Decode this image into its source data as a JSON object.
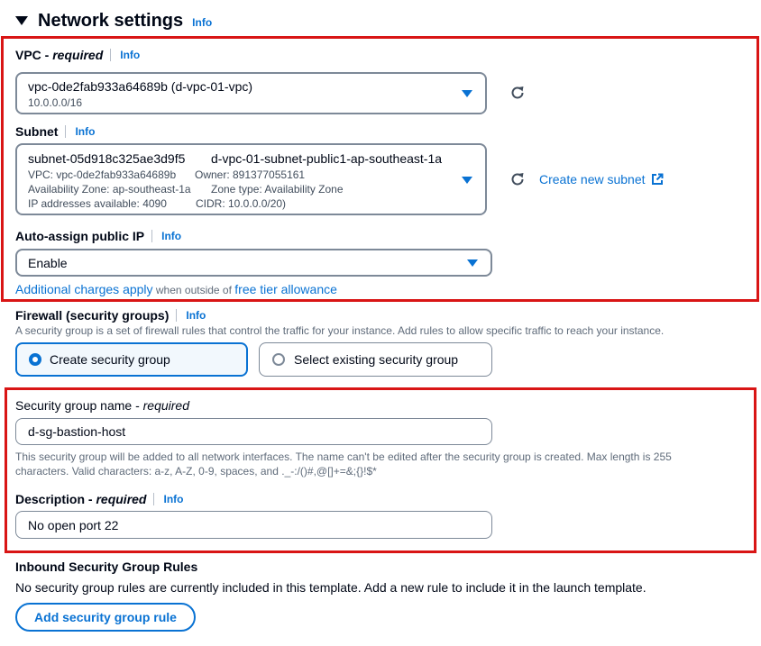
{
  "section": {
    "title": "Network settings",
    "info": "Info"
  },
  "vpc": {
    "label_main": "VPC - ",
    "label_req": "required",
    "info": "Info",
    "value": "vpc-0de2fab933a64689b (d-vpc-01-vpc)",
    "sub": "10.0.0.0/16"
  },
  "subnet": {
    "label": "Subnet",
    "info": "Info",
    "id": "subnet-05d918c325ae3d9f5",
    "name": "d-vpc-01-subnet-public1-ap-southeast-1a",
    "vpc_line": "VPC: vpc-0de2fab933a64689b",
    "owner_line": "Owner: 891377055161",
    "az_line": "Availability Zone: ap-southeast-1a",
    "zone_type_line": "Zone type: Availability Zone",
    "ips_line": "IP addresses available: 4090",
    "cidr_line": "CIDR: 10.0.0.0/20)",
    "create_link": "Create new subnet"
  },
  "auto_ip": {
    "label": "Auto-assign public IP",
    "info": "Info",
    "value": "Enable",
    "charges_link": "Additional charges apply",
    "charges_mid": " when outside of ",
    "free_tier_link": "free tier allowance"
  },
  "firewall": {
    "label": "Firewall (security groups)",
    "info": "Info",
    "description": "A security group is a set of firewall rules that control the traffic for your instance. Add rules to allow specific traffic to reach your instance.",
    "option_create": "Create security group",
    "option_select": "Select existing security group",
    "selected": "Create security group"
  },
  "sg_name": {
    "label_main": "Security group name - ",
    "label_req": "required",
    "value": "d-sg-bastion-host",
    "hint_line1": "This security group will be added to all network interfaces. The name can't be edited after the security group is created. Max length is 255",
    "hint_line2": "characters. Valid characters: a-z, A-Z, 0-9, spaces, and ._-:/()#,@[]+=&;{}!$*"
  },
  "description": {
    "label_main": "Description - ",
    "label_req": "required",
    "info": "Info",
    "value": "No open port 22"
  },
  "inbound": {
    "title": "Inbound Security Group Rules",
    "text": "No security group rules are currently included in this template. Add a new rule to include it in the launch template.",
    "add_button": "Add security group rule"
  },
  "colors": {
    "accent": "#0972d3",
    "highlight_border": "#d91515",
    "text": "#000716"
  }
}
